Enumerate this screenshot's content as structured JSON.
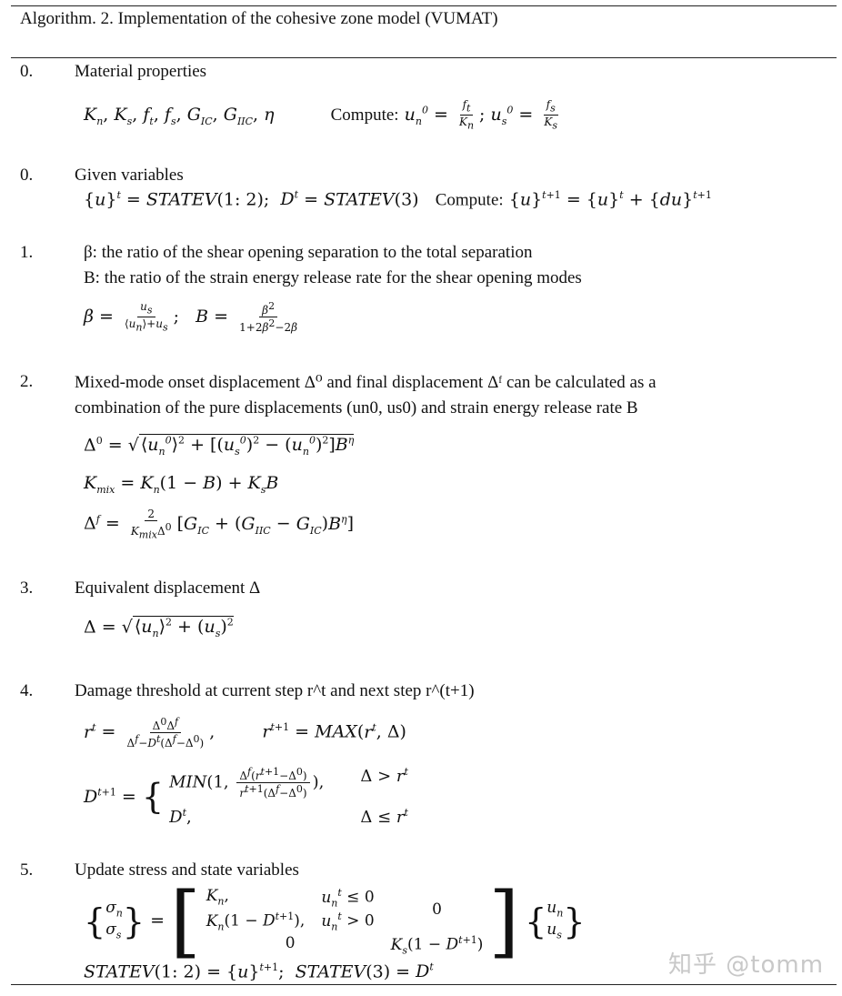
{
  "title": "Algorithm. 2. Implementation of the cohesive zone model (VUMAT)",
  "steps": [
    {
      "number": "0.",
      "heading": "Material properties",
      "equations": {
        "props": "Kn, Ks, ft, fs, GIC, GIIC, η",
        "compute_label": "Compute:",
        "u_n0": "un0 = ft / Kn",
        "u_s0": "us0 = fs / Ks"
      }
    },
    {
      "number": "0.",
      "heading": "Given variables",
      "equations": {
        "given": "{u}^t = STATEV(1:2); D^t = STATEV(3)",
        "compute_label": "Compute:",
        "compute": "{u}^(t+1) = {u}^t + {du}^(t+1)"
      }
    },
    {
      "number": "1.",
      "lines": [
        "β: the ratio of the shear opening separation to the total separation",
        "B: the ratio of the strain energy release rate for the shear opening modes"
      ],
      "equations": {
        "beta": "β = us / (⟨un⟩ + us)",
        "B": "B = β² / (1 + 2β² − 2β)"
      }
    },
    {
      "number": "2.",
      "lines": [
        "Mixed-mode onset displacement Δ⁰ and final displacement Δᶠ can be calculated as a",
        "combination of the pure displacements (un0, us0) and strain energy release rate B"
      ],
      "equations": {
        "delta0": "Δ⁰ = √(⟨un0⟩² + [(us0)² − (un0)²]B^η)",
        "kmix": "Kmix = Kn(1 − B) + KsB",
        "deltaf": "Δᶠ = 2/(Kmix Δ⁰) [GIC + (GIIC − GIC)B^η]"
      }
    },
    {
      "number": "3.",
      "heading": "Equivalent displacement Δ",
      "equations": {
        "delta": "Δ = √(⟨un⟩² + (us)²)"
      }
    },
    {
      "number": "4.",
      "heading": "Damage threshold at current step r^t and next step r^(t+1)",
      "equations": {
        "rt": "r^t = Δ⁰Δᶠ / (Δᶠ − D^t(Δᶠ − Δ⁰))",
        "rt1": "r^(t+1) = MAX(r^t, Δ)",
        "damage_case1": "MIN(1, Δᶠ(r^(t+1) − Δ⁰) / (r^(t+1)(Δᶠ − Δ⁰))),",
        "damage_cond1": "Δ > r^t",
        "damage_case2": "D^t,",
        "damage_cond2": "Δ ≤ r^t"
      }
    },
    {
      "number": "5.",
      "heading": "Update stress and state variables",
      "equations": {
        "matrix": [
          [
            "Kn,  un^t ≤ 0 | Kn(1 − D^(t+1)),  un^t > 0",
            "0"
          ],
          [
            "0",
            "Ks(1 − D^(t+1))"
          ]
        ],
        "statev": "STATEV(1:2) = {u}^(t+1); STATEV(3) = D^t"
      }
    }
  ],
  "watermark": "知乎 @tomm"
}
